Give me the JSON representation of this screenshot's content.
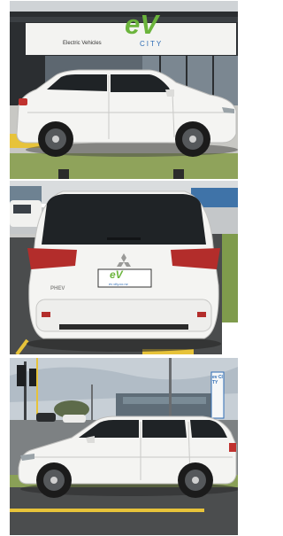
{
  "photos": [
    {
      "view": "side",
      "sign": {
        "logo_letters": "eV",
        "tagline": "Electric Vehicles",
        "sub": "CITY"
      }
    },
    {
      "view": "rear",
      "plate": {
        "logo_letters": "eV",
        "dealer": "ev city.co.nz"
      },
      "badges": {
        "model": "PHEV",
        "brand_mark": "Mitsubishi"
      }
    },
    {
      "view": "side",
      "flag": {
        "text": "ev CITY"
      }
    }
  ],
  "colors": {
    "car_body": "#f4f4f2",
    "window": "#1f2326",
    "ev_green": "#6bb43c",
    "ev_blue": "#2f6db5",
    "lawn": "#8fa35b",
    "asphalt": "#4a4c4d",
    "parking_line": "#e7c33a"
  }
}
